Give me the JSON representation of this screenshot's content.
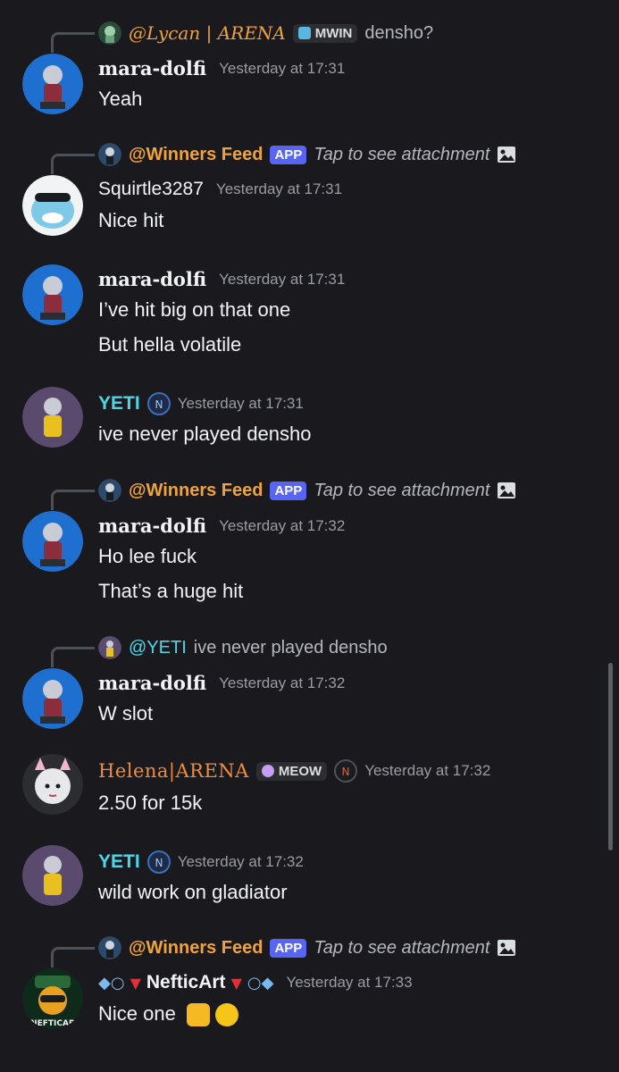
{
  "messages": [
    {
      "reply": {
        "name": "@Lycan | ARENA",
        "tag": "MWIN",
        "text": "densho?"
      },
      "author": "mara-dolfi",
      "timestamp": "Yesterday at 17:31",
      "lines": [
        "Yeah"
      ]
    },
    {
      "reply": {
        "name": "@Winners Feed",
        "app": "APP",
        "text": "Tap to see attachment"
      },
      "author": "Squirtle3287",
      "timestamp": "Yesterday at 17:31",
      "lines": [
        "Nice hit"
      ]
    },
    {
      "author": "mara-dolfi",
      "timestamp": "Yesterday at 17:31",
      "lines": [
        "I’ve hit big on that one",
        "But hella volatile"
      ]
    },
    {
      "author": "YETI",
      "timestamp": "Yesterday at 17:31",
      "lines": [
        "ive never played densho"
      ]
    },
    {
      "reply": {
        "name": "@Winners Feed",
        "app": "APP",
        "text": "Tap to see attachment"
      },
      "author": "mara-dolfi",
      "timestamp": "Yesterday at 17:32",
      "lines": [
        "Ho lee fuck",
        "That’s a huge hit"
      ]
    },
    {
      "reply": {
        "name": "@YETI",
        "text": "ive never played densho"
      },
      "author": "mara-dolfi",
      "timestamp": "Yesterday at 17:32",
      "lines": [
        "W slot"
      ]
    },
    {
      "author": "Helena|ARENA",
      "tag": "MEOW",
      "timestamp": "Yesterday at 17:32",
      "lines": [
        "2.50 for 15k"
      ]
    },
    {
      "author": "YETI",
      "timestamp": "Yesterday at 17:32",
      "lines": [
        "wild work on gladiator"
      ]
    },
    {
      "reply": {
        "name": "@Winners Feed",
        "app": "APP",
        "text": "Tap to see attachment"
      },
      "author": "NefticArt",
      "timestamp": "Yesterday at 17:33",
      "lines": [
        "Nice one"
      ],
      "avatar_text": "NEFTICAR"
    }
  ],
  "colors": {
    "background": "#1a1a1e",
    "yeti_name": "#4ad8e8",
    "helena_name": "#f08c3a",
    "app_tag": "#5865f2",
    "lycan_name": "#f0a33a"
  }
}
